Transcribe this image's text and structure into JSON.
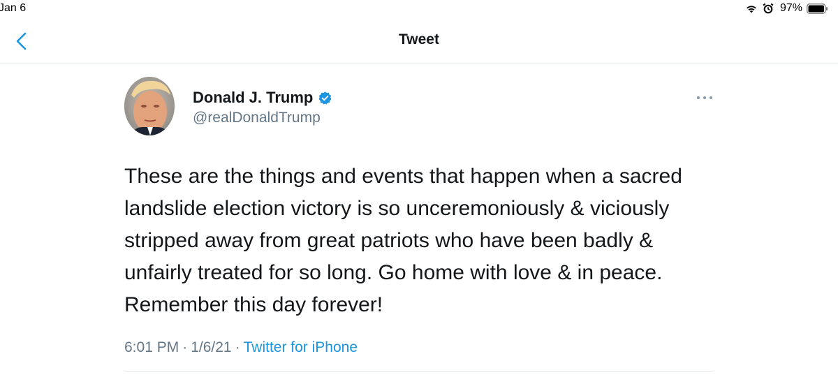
{
  "status_bar": {
    "date": "Jan 6",
    "battery_percent": "97%",
    "icons": [
      "wifi-icon",
      "alarm-icon",
      "battery-icon"
    ]
  },
  "nav": {
    "back_icon": "chevron-left-icon",
    "title": "Tweet"
  },
  "tweet": {
    "display_name": "Donald J. Trump",
    "verified": true,
    "handle": "@realDonaldTrump",
    "more_icon": "more-dots-icon",
    "text": "These are the things and events that happen when a sacred landslide election victory is so unceremoniously & viciously stripped away from great patriots who have been badly & unfairly treated for so long. Go home with love & in peace. Remember this day forever!",
    "time": "6:01 PM",
    "separator": "·",
    "date": "1/6/21",
    "source": "Twitter for iPhone"
  },
  "colors": {
    "accent": "#1b95e0",
    "text": "#14171a",
    "secondary": "#657786",
    "divider": "#e6ecf0"
  }
}
